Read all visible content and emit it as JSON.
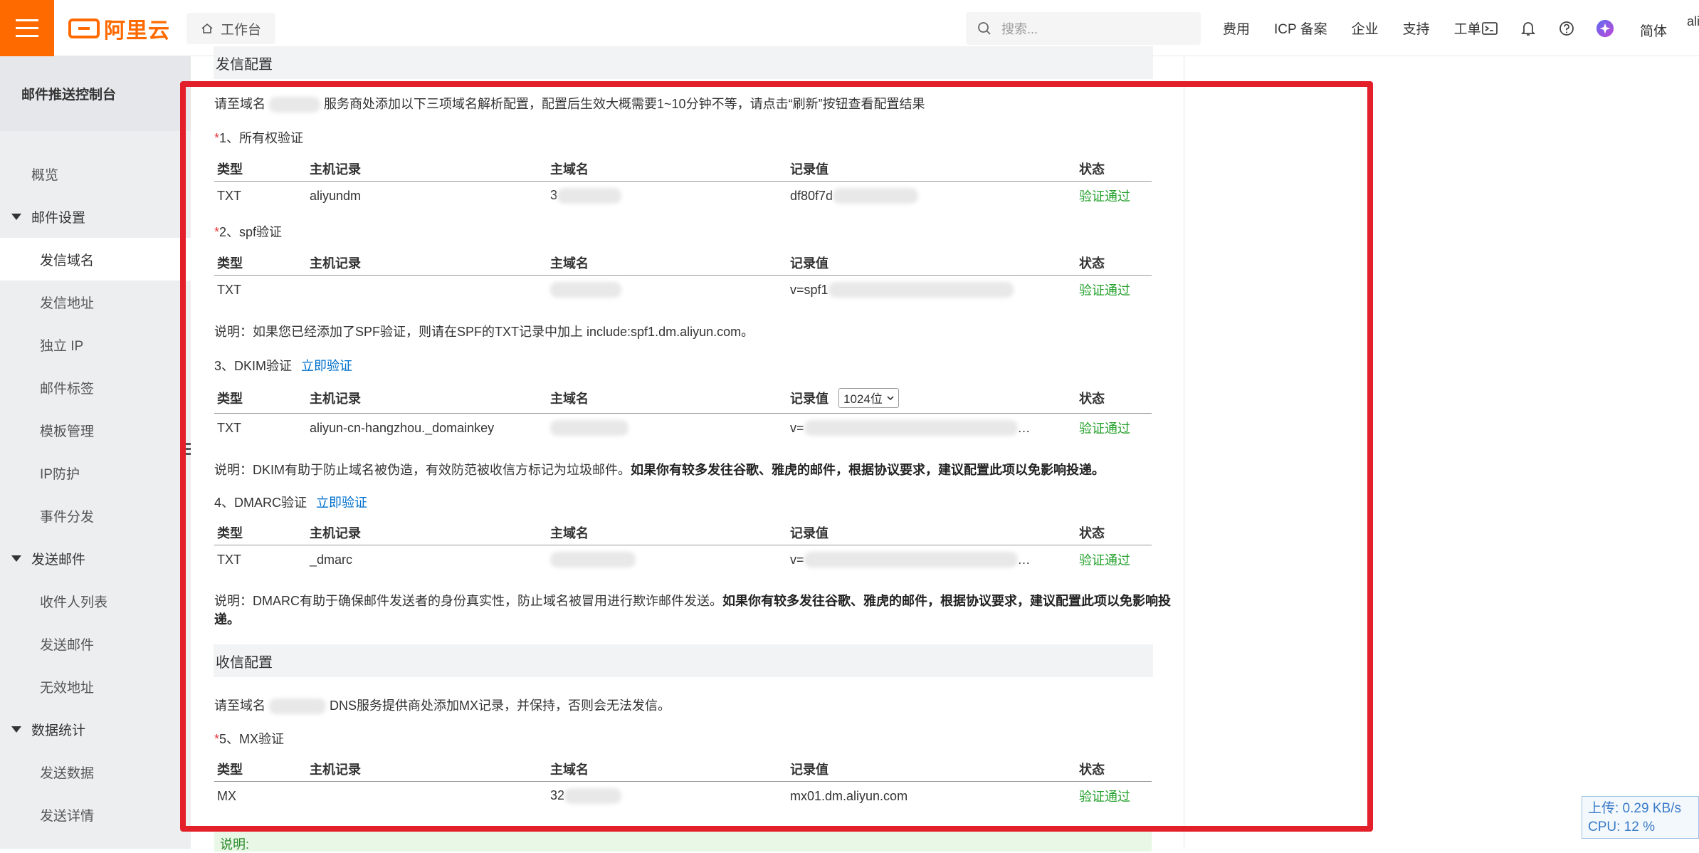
{
  "header": {
    "brand": "阿里云",
    "workbench": "工作台",
    "search_placeholder": "搜索...",
    "nav": [
      "费用",
      "ICP 备案",
      "企业",
      "支持",
      "工单"
    ],
    "lang": "简体",
    "user_trunc": "ali"
  },
  "sidebar": {
    "title": "邮件推送控制台",
    "items": [
      {
        "label": "概览"
      },
      {
        "label": "邮件设置"
      },
      {
        "label": "发信域名"
      },
      {
        "label": "发信地址"
      },
      {
        "label": "独立 IP"
      },
      {
        "label": "邮件标签"
      },
      {
        "label": "模板管理"
      },
      {
        "label": "IP防护"
      },
      {
        "label": "事件分发"
      },
      {
        "label": "发送邮件"
      },
      {
        "label": "收件人列表"
      },
      {
        "label": "发送邮件"
      },
      {
        "label": "无效地址"
      },
      {
        "label": "数据统计"
      },
      {
        "label": "发送数据"
      },
      {
        "label": "发送详情"
      }
    ]
  },
  "send_config": {
    "heading": "发信配置",
    "intro_a": "请至域名",
    "intro_b": "服务商处添加以下三项域名解析配置，配置后生效大概需要1~10分钟不等，请点击“刷新”按钮查看配置结果",
    "columns": [
      "类型",
      "主机记录",
      "主域名",
      "记录值",
      "状态"
    ],
    "s1_title": "1、所有权验证",
    "s1_row": {
      "type": "TXT",
      "host": "aliyundm",
      "domain": "3",
      "value": "df80f7d",
      "status": "验证通过"
    },
    "s2_title": "2、spf验证",
    "s2_row": {
      "type": "TXT",
      "host": "",
      "domain": "",
      "value": "v=spf1",
      "status": "验证通过"
    },
    "s2_note": "说明：如果您已经添加了SPF验证，则请在SPF的TXT记录中加上 include:spf1.dm.aliyun.com。",
    "s3_title": "3、DKIM验证",
    "s3_link": "立即验证",
    "s3_select": "1024位",
    "s3_row": {
      "type": "TXT",
      "host": "aliyun-cn-hangzhou._domainkey",
      "domain": "",
      "value": "v=",
      "status": "验证通过"
    },
    "s3_note_a": "说明：DKIM有助于防止域名被伪造，有效防范被收信方标记为垃圾邮件。",
    "s3_note_b": "如果你有较多发往谷歌、雅虎的邮件，根据协议要求，建议配置此项以免影响投递。",
    "s4_title": "4、DMARC验证",
    "s4_link": "立即验证",
    "s4_row": {
      "type": "TXT",
      "host": "_dmarc",
      "domain": "",
      "value": "v=",
      "status": "验证通过"
    },
    "s4_note_a": "说明：DMARC有助于确保邮件发送者的身份真实性，防止域名被冒用进行欺诈邮件发送。",
    "s4_note_b": "如果你有较多发往谷歌、雅虎的邮件，根据协议要求，建议配置此项以免影响投",
    "s4_note_c": "递。"
  },
  "recv_config": {
    "heading": "收信配置",
    "intro_a": "请至域名",
    "intro_b": "DNS服务提供商处添加MX记录，并保持，否则会无法发信。",
    "s5_title": "5、MX验证",
    "s5_row": {
      "type": "MX",
      "host": "",
      "domain": "32",
      "value": "mx01.dm.aliyun.com",
      "status": "验证通过"
    },
    "note": "说明:"
  },
  "perf": {
    "upload": "上传: 0.29 KB/s",
    "cpu": "CPU: 12 %"
  },
  "colors": {
    "brand": "#ff6a00",
    "ok": "#23a02b",
    "link": "#0070cc",
    "frame": "#e3202a"
  }
}
